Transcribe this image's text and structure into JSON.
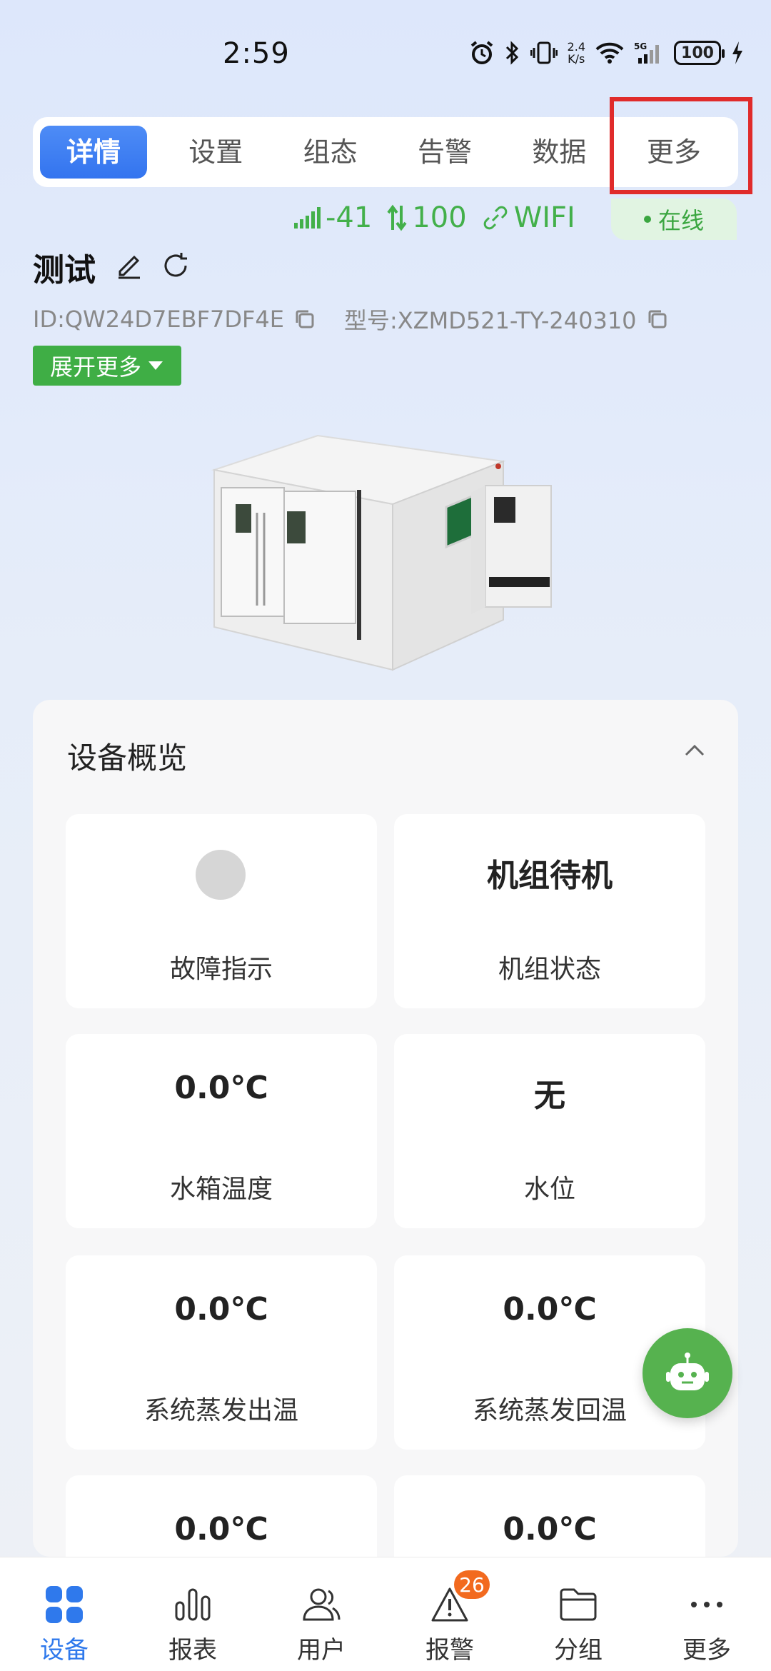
{
  "status_bar": {
    "time": "2:59",
    "network_speed_value": "2.4",
    "network_speed_unit": "K/s",
    "battery": "100"
  },
  "tabs": [
    {
      "label": "详情",
      "active": true
    },
    {
      "label": "设置"
    },
    {
      "label": "组态"
    },
    {
      "label": "告警"
    },
    {
      "label": "数据"
    },
    {
      "label": "更多"
    }
  ],
  "connection": {
    "signal": "-41",
    "data": "100",
    "type": "WIFI",
    "status": "在线"
  },
  "device": {
    "name": "测试",
    "id": "ID:QW24D7EBF7DF4E",
    "model": "型号:XZMD521-TY-240310",
    "expand_label": "展开更多"
  },
  "overview": {
    "title": "设备概览",
    "tiles": [
      {
        "value": "",
        "label": "故障指示"
      },
      {
        "value": "机组待机",
        "label": "机组状态"
      },
      {
        "value": "0.0℃",
        "label": "水箱温度"
      },
      {
        "value": "无",
        "label": "水位"
      },
      {
        "value": "0.0℃",
        "label": "系统蒸发出温"
      },
      {
        "value": "0.0℃",
        "label": "系统蒸发回温"
      },
      {
        "value": "0.0℃",
        "label": ""
      },
      {
        "value": "0.0℃",
        "label": ""
      }
    ]
  },
  "bottom_nav": [
    {
      "label": "设备",
      "active": true
    },
    {
      "label": "报表"
    },
    {
      "label": "用户"
    },
    {
      "label": "报警",
      "badge": "26"
    },
    {
      "label": "分组"
    },
    {
      "label": "更多"
    }
  ],
  "colors": {
    "primary": "#3374ef",
    "green": "#3fae45",
    "badge": "#f26a1f",
    "highlight": "#e02b2b"
  }
}
